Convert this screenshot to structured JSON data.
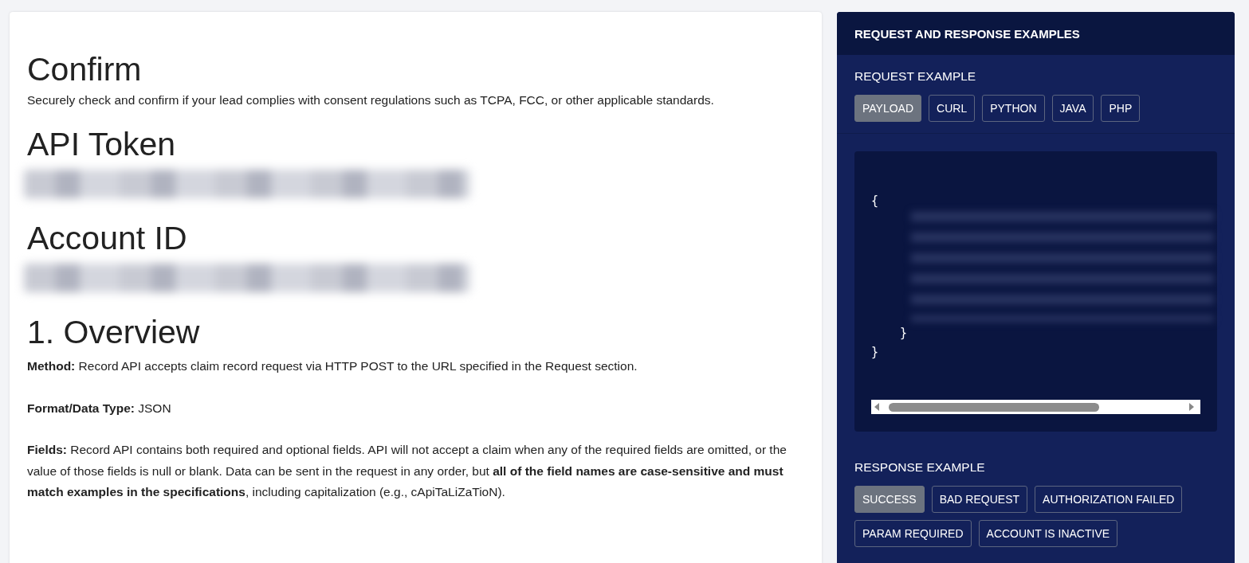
{
  "doc": {
    "title": "Confirm",
    "description": "Securely check and confirm if your lead complies with consent regulations such as TCPA, FCC, or other applicable standards.",
    "secrets": [
      {
        "heading": "API Token"
      },
      {
        "heading": "Account ID"
      }
    ],
    "overview": {
      "heading": "1. Overview",
      "paragraphs": [
        "**Method:** Record API accepts claim record request via HTTP POST to the URL specified in the Request section.",
        "**Format/Data Type:** JSON",
        "**Fields:** Record API contains both required and optional fields. API will not accept a claim when any of the required fields are omitted, or the value of those fields is null or blank. Data can be sent in the request in any order, but **all of the field names are case-sensitive and must match examples in the specifications**, including capitalization (e.g., cApiTaLiZaTioN)."
      ]
    }
  },
  "examples": {
    "header": "REQUEST AND RESPONSE EXAMPLES",
    "request": {
      "label": "REQUEST EXAMPLE",
      "tabs": [
        {
          "label": "PAYLOAD",
          "selected": true
        },
        {
          "label": "CURL",
          "selected": false
        },
        {
          "label": "PYTHON",
          "selected": false
        },
        {
          "label": "JAVA",
          "selected": false
        },
        {
          "label": "PHP",
          "selected": false
        }
      ],
      "code": {
        "open": "{",
        "inner_close": "}",
        "close": "}"
      }
    },
    "response": {
      "label": "RESPONSE EXAMPLE",
      "tabs": [
        {
          "label": "SUCCESS",
          "selected": true
        },
        {
          "label": "BAD REQUEST",
          "selected": false
        },
        {
          "label": "AUTHORIZATION FAILED",
          "selected": false
        },
        {
          "label": "PARAM REQUIRED",
          "selected": false
        },
        {
          "label": "ACCOUNT IS INACTIVE",
          "selected": false
        }
      ]
    }
  }
}
